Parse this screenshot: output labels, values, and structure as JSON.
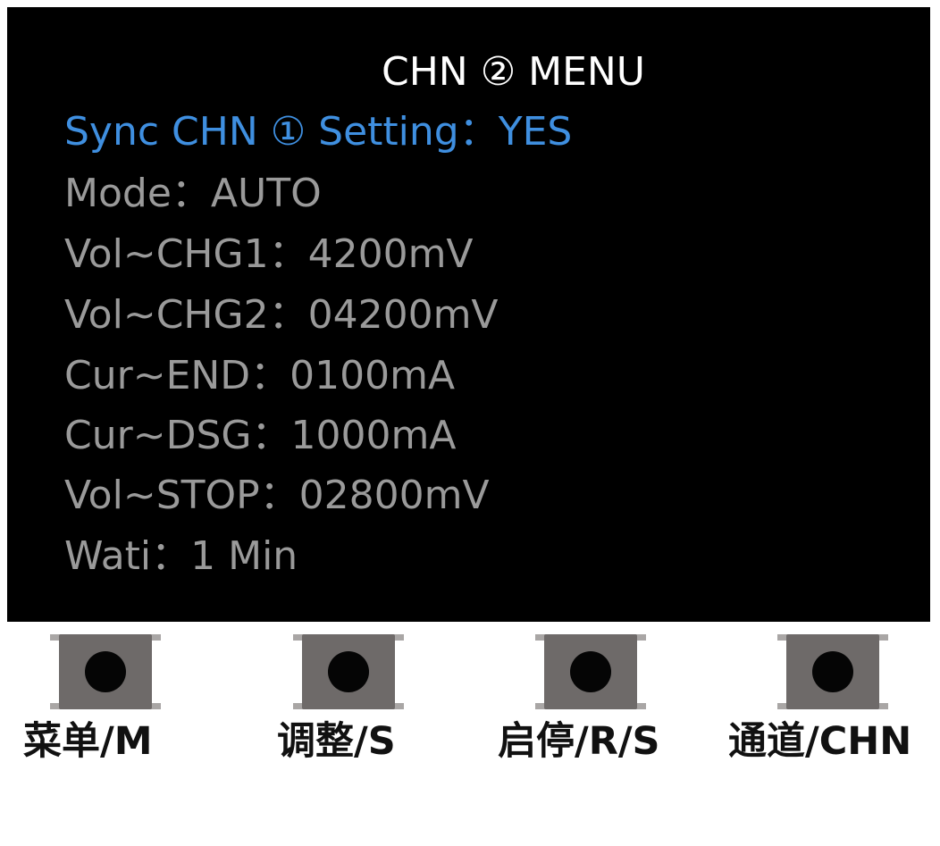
{
  "screen": {
    "title": "CHN ② MENU",
    "items": [
      {
        "label": "Sync CHN ① Setting：",
        "value": "YES",
        "selected": true
      },
      {
        "label": "Mode：",
        "value": "AUTO",
        "selected": false
      },
      {
        "label": "Vol~CHG1：",
        "value": "4200mV",
        "selected": false
      },
      {
        "label": "Vol~CHG2：",
        "value": "04200mV",
        "selected": false
      },
      {
        "label": "Cur~END：",
        "value": "0100mA",
        "selected": false
      },
      {
        "label": "Cur~DSG：",
        "value": "1000mA",
        "selected": false
      },
      {
        "label": "Vol~STOP：",
        "value": "02800mV",
        "selected": false
      },
      {
        "label": "Wati：",
        "value": "1 Min",
        "selected": false
      }
    ],
    "colors": {
      "background": "#000000",
      "title": "#ffffff",
      "selected": "#3f8fe0",
      "normal": "#9a9a9a"
    }
  },
  "buttons": [
    {
      "label": "菜单/M"
    },
    {
      "label": "调整/S"
    },
    {
      "label": "启停/R/S"
    },
    {
      "label": "通道/CHN"
    }
  ]
}
